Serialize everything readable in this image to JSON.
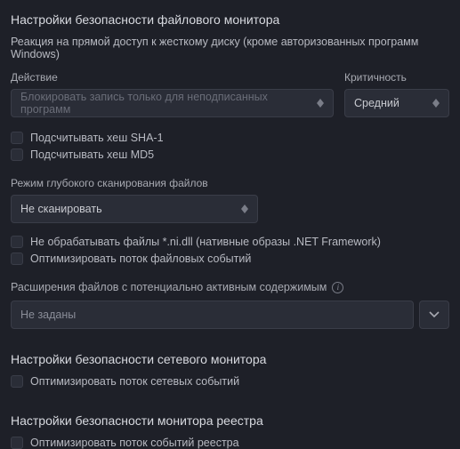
{
  "fileMonitor": {
    "title": "Настройки безопасности файлового монитора",
    "subtitle": "Реакция на прямой доступ к жесткому диску (кроме авторизованных программ Windows)",
    "actionLabel": "Действие",
    "actionValue": "Блокировать запись только для неподписанных программ",
    "criticalityLabel": "Критичность",
    "criticalityValue": "Средний",
    "sha1": "Подсчитывать хеш SHA-1",
    "md5": "Подсчитывать хеш MD5",
    "deepScanLabel": "Режим глубокого сканирования файлов",
    "deepScanValue": "Не сканировать",
    "skipNiDll": "Не обрабатывать файлы *.ni.dll (нативные образы .NET Framework)",
    "optimizeFileEvents": "Оптимизировать поток файловых событий",
    "activeExtLabel": "Расширения файлов с потенциально активным содержимым",
    "activeExtValue": "Не заданы"
  },
  "networkMonitor": {
    "title": "Настройки безопасности сетевого монитора",
    "optimize": "Оптимизировать поток сетевых событий"
  },
  "registryMonitor": {
    "title": "Настройки безопасности монитора реестра",
    "optimize": "Оптимизировать поток событий реестра"
  }
}
